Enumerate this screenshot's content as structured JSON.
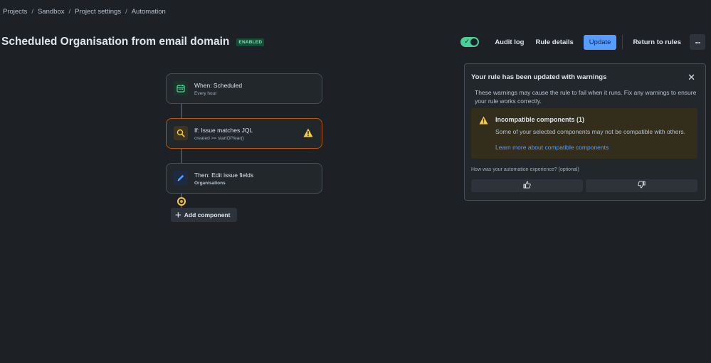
{
  "breadcrumb": {
    "items": [
      "Projects",
      "Sandbox",
      "Project settings",
      "Automation"
    ],
    "separator": "/"
  },
  "header": {
    "title": "Scheduled Organisation from email domain",
    "status_badge": "ENABLED"
  },
  "toolbar": {
    "toggle_enabled": true,
    "audit_log": "Audit log",
    "rule_details": "Rule details",
    "update": "Update",
    "return_to_rules": "Return to rules",
    "more_icon": "more-horizontal-icon"
  },
  "flow": {
    "cards": [
      {
        "title": "When: Scheduled",
        "subtitle": "Every hour",
        "icon": "calendar-icon"
      },
      {
        "title": "If: Issue matches JQL",
        "subtitle": "created >= startOfYear()",
        "icon": "search-icon",
        "warning": true
      },
      {
        "title": "Then: Edit issue fields",
        "subtitle": "Organisations",
        "icon": "pencil-icon"
      }
    ],
    "add_component": "Add component"
  },
  "panel": {
    "title": "Your rule has been updated with warnings",
    "description": "These warnings may cause the rule to fail when it runs. Fix any warnings to ensure your rule works correctly.",
    "warning_title": "Incompatible components (1)",
    "warning_text": "Some of your selected components may not be compatible with others.",
    "warning_link": "Learn more about compatible components",
    "feedback_label": "How was your automation experience? (optional)"
  },
  "colors": {
    "background": "#1d2125",
    "primary": "#579dff",
    "success": "#4bce97",
    "warning": "#e2b203",
    "warning_border": "#c25100"
  }
}
